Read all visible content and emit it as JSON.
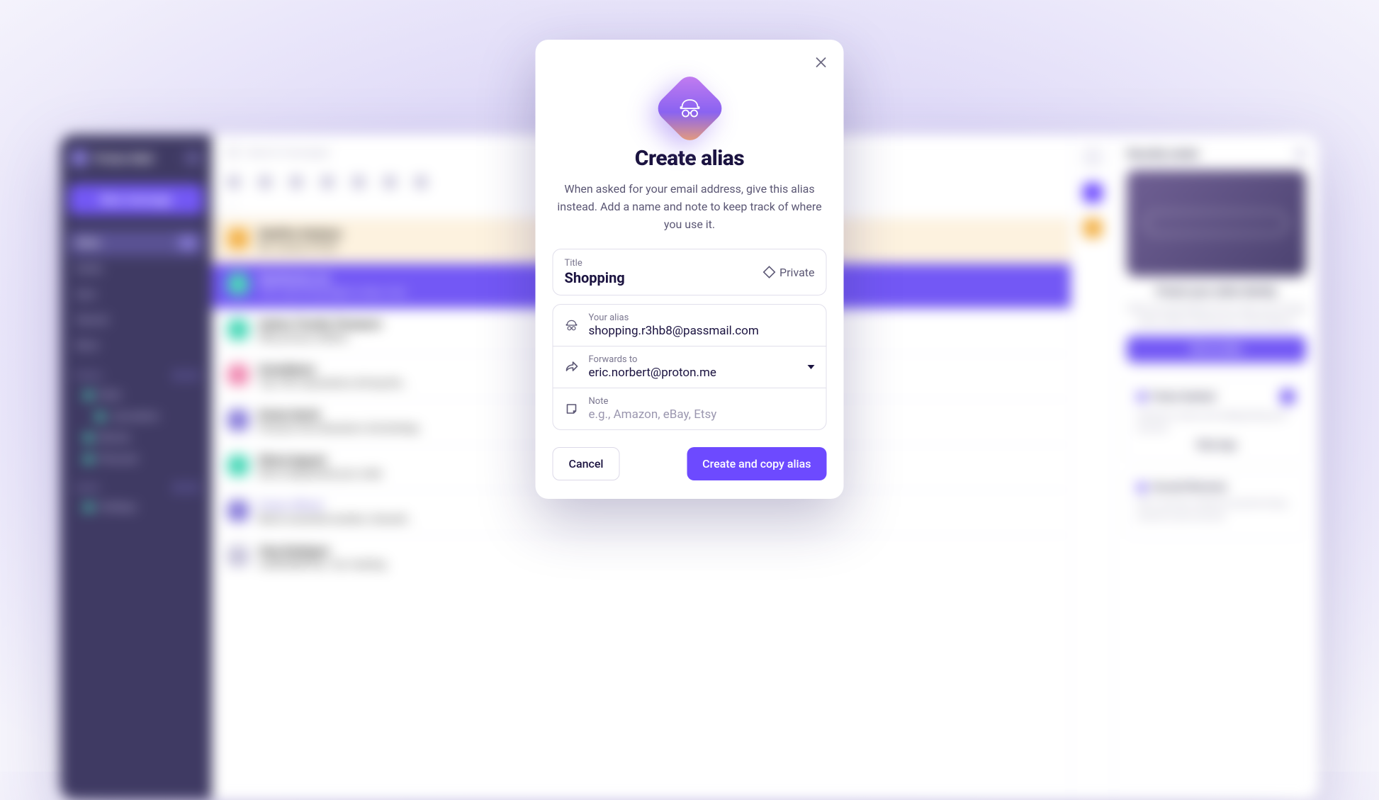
{
  "bg": {
    "app_name": "Proton Mail",
    "new_message": "New message",
    "search_placeholder": "Search messages",
    "nav": {
      "inbox": "Inbox",
      "drafts": "Drafts",
      "sent": "Sent",
      "starred": "Starred",
      "more": "More"
    },
    "sections": {
      "folders": "Folders",
      "labels": "Labels"
    },
    "folders": {
      "work": "Work",
      "journalism": "Journalism",
      "movies": "Movies",
      "personal": "Personal"
    },
    "labels": {
      "holidays": "Holidays"
    },
    "messages": [
      {
        "sender": "DataFlex Solutions",
        "subject": "Re: Invoice #1923"
      },
      {
        "sender": "SkyAtlantica Air",
        "subject": "Your upcoming flight to New York"
      },
      {
        "sender": "Andrew Timothy Thompson",
        "subject": "Why privacy matters"
      },
      {
        "sender": "GreenNature",
        "subject": "Top 100 corporations driving the…"
      },
      {
        "sender": "Kristen Nevitt",
        "subject": "Pictures from Brandon's 3rd birthday"
      },
      {
        "sender": "Ethical Apparel",
        "subject": "We've dispatched your order"
      },
      {
        "sender": "Proton Official",
        "subject": "Block unwanted senders, farewell…"
      },
      {
        "sender": "Clara Rodriguez",
        "subject": "CONFIDENTIAL: Our meeting"
      }
    ],
    "panel": {
      "title": "Security center",
      "heading": "Protect your online identity",
      "desc": "Hide-my-email aliases let you sign up for things online without sharing your email address.",
      "cta": "Get an alias",
      "sentinel": {
        "title": "Proton Sentinel",
        "desc": "Sentinel is active and safeguarding your account",
        "link": "View logs"
      },
      "recovery": {
        "title": "Account Recovery",
        "desc": "Set a recovery method to prevent losing access to your account"
      }
    }
  },
  "modal": {
    "title": "Create alias",
    "description": "When asked for your email address, give this alias instead. Add a name and note to keep track of where you use it.",
    "title_field": {
      "label": "Title",
      "value": "Shopping"
    },
    "vault": {
      "label": "Private"
    },
    "alias_field": {
      "label": "Your alias",
      "value": "shopping.r3hb8@passmail.com"
    },
    "forwards_field": {
      "label": "Forwards to",
      "value": "eric.norbert@proton.me"
    },
    "note_field": {
      "label": "Note",
      "placeholder": "e.g., Amazon, eBay, Etsy"
    },
    "buttons": {
      "cancel": "Cancel",
      "submit": "Create and copy alias"
    }
  }
}
